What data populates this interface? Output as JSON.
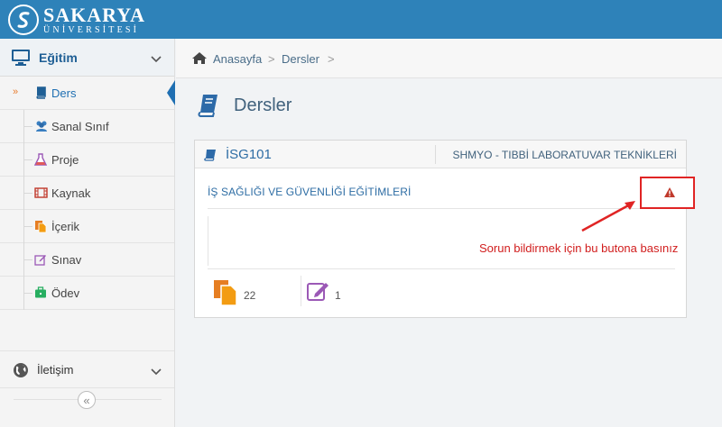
{
  "header": {
    "logo_main": "SAKARYA",
    "logo_sub": "ÜNİVERSİTESİ",
    "bg_color": "#2e82b9"
  },
  "sidebar": {
    "section_label": "Eğitim",
    "section_icon": "monitor-icon",
    "items": [
      {
        "label": "Ders",
        "icon": "book-icon",
        "active": true
      },
      {
        "label": "Sanal Sınıf",
        "icon": "users-icon",
        "active": false
      },
      {
        "label": "Proje",
        "icon": "flask-icon",
        "active": false
      },
      {
        "label": "Kaynak",
        "icon": "film-icon",
        "active": false
      },
      {
        "label": "İçerik",
        "icon": "files-icon",
        "active": false
      },
      {
        "label": "Sınav",
        "icon": "edit-icon",
        "active": false
      },
      {
        "label": "Ödev",
        "icon": "briefcase-icon",
        "active": false
      }
    ],
    "contact_label": "İletişim",
    "contact_icon": "globe-icon",
    "collapse_icon": "double-chevron-left-icon"
  },
  "breadcrumb": {
    "items": [
      "Anasayfa",
      "Dersler"
    ],
    "separator": ">"
  },
  "page": {
    "title": "Dersler"
  },
  "course": {
    "code": "İSG101",
    "department": "SHMYO - TIBBİ LABORATUVAR TEKNİKLERİ",
    "name": "İŞ SAĞLIĞI VE GÜVENLİĞİ EĞİTİMLERİ",
    "content_count": "22",
    "exam_count": "1"
  },
  "annotation": {
    "text": "Sorun bildirmek için bu butona basınız",
    "color": "#d11d1d"
  }
}
